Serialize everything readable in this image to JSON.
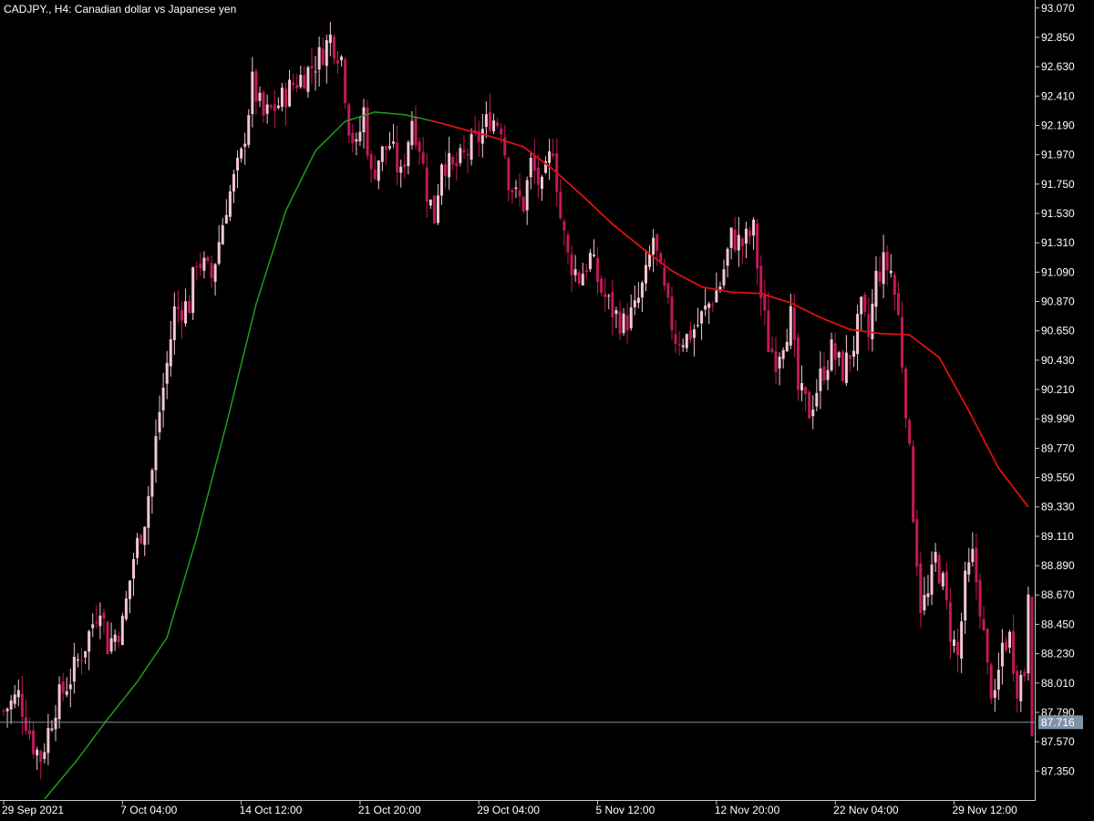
{
  "chart_title": "CADJPY., H4:  Canadian dollar vs Japanese yen",
  "colors": {
    "background": "#000000",
    "axis_line": "#c8c8c8",
    "candle_bear": "#c2185b",
    "candle_bull": "#f2c6d2",
    "ma_rising": "#1e9e1e",
    "ma_falling": "#e01010",
    "price_line": "#7f93a8",
    "price_label_bg": "#7f93a8"
  },
  "chart_data": {
    "type": "candlestick",
    "symbol": "CADJPY.",
    "timeframe": "H4",
    "y_ticks": [
      "93.070",
      "92.850",
      "92.630",
      "92.410",
      "92.190",
      "91.970",
      "91.750",
      "91.530",
      "91.310",
      "91.090",
      "90.870",
      "90.650",
      "90.430",
      "90.210",
      "89.990",
      "89.770",
      "89.550",
      "89.330",
      "89.110",
      "88.890",
      "88.670",
      "88.450",
      "88.230",
      "88.010",
      "87.790",
      "87.570",
      "87.350"
    ],
    "ylim": [
      87.14,
      93.13
    ],
    "x_ticks": [
      {
        "label": "29 Sep 2021",
        "bar": 0
      },
      {
        "label": "7 Oct 04:00",
        "bar": 32
      },
      {
        "label": "14 Oct 12:00",
        "bar": 64
      },
      {
        "label": "21 Oct 20:00",
        "bar": 96
      },
      {
        "label": "29 Oct 04:00",
        "bar": 128
      },
      {
        "label": "5 Nov 12:00",
        "bar": 160
      },
      {
        "label": "12 Nov 20:00",
        "bar": 192
      },
      {
        "label": "22 Nov 04:00",
        "bar": 224
      },
      {
        "label": "29 Nov 12:00",
        "bar": 256
      }
    ],
    "current_price": "87.716",
    "current_price_value": 87.716,
    "bar_count": 278,
    "price_path": [
      [
        0,
        87.8
      ],
      [
        4,
        87.92
      ],
      [
        8,
        87.55
      ],
      [
        10,
        87.45
      ],
      [
        14,
        87.85
      ],
      [
        18,
        88.05
      ],
      [
        22,
        88.3
      ],
      [
        26,
        88.62
      ],
      [
        28,
        88.3
      ],
      [
        32,
        88.45
      ],
      [
        35,
        88.95
      ],
      [
        38,
        89.25
      ],
      [
        40,
        89.6
      ],
      [
        42,
        90.05
      ],
      [
        44,
        90.4
      ],
      [
        46,
        90.8
      ],
      [
        50,
        90.85
      ],
      [
        52,
        91.2
      ],
      [
        56,
        91.05
      ],
      [
        60,
        91.6
      ],
      [
        64,
        91.95
      ],
      [
        67,
        92.5
      ],
      [
        70,
        92.25
      ],
      [
        74,
        92.35
      ],
      [
        78,
        92.5
      ],
      [
        82,
        92.6
      ],
      [
        85,
        92.7
      ],
      [
        88,
        92.85
      ],
      [
        91,
        92.7
      ],
      [
        93,
        92.2
      ],
      [
        95,
        92.0
      ],
      [
        97,
        92.3
      ],
      [
        99,
        91.8
      ],
      [
        101,
        91.95
      ],
      [
        104,
        92.05
      ],
      [
        107,
        91.8
      ],
      [
        110,
        92.25
      ],
      [
        112,
        92.05
      ],
      [
        114,
        91.7
      ],
      [
        116,
        91.5
      ],
      [
        118,
        91.95
      ],
      [
        121,
        91.85
      ],
      [
        124,
        91.95
      ],
      [
        128,
        92.1
      ],
      [
        131,
        92.25
      ],
      [
        134,
        92.2
      ],
      [
        136,
        91.8
      ],
      [
        138,
        91.65
      ],
      [
        140,
        91.6
      ],
      [
        142,
        91.9
      ],
      [
        145,
        91.7
      ],
      [
        148,
        92.05
      ],
      [
        150,
        91.5
      ],
      [
        152,
        91.2
      ],
      [
        155,
        91.05
      ],
      [
        158,
        91.2
      ],
      [
        161,
        90.95
      ],
      [
        164,
        90.8
      ],
      [
        167,
        90.7
      ],
      [
        170,
        90.8
      ],
      [
        173,
        91.05
      ],
      [
        175,
        91.35
      ],
      [
        177,
        91.05
      ],
      [
        179,
        90.8
      ],
      [
        181,
        90.6
      ],
      [
        184,
        90.6
      ],
      [
        187,
        90.7
      ],
      [
        190,
        90.85
      ],
      [
        193,
        91.0
      ],
      [
        196,
        91.35
      ],
      [
        199,
        91.3
      ],
      [
        202,
        91.4
      ],
      [
        204,
        90.9
      ],
      [
        206,
        90.55
      ],
      [
        208,
        90.45
      ],
      [
        210,
        90.6
      ],
      [
        212,
        90.75
      ],
      [
        214,
        90.2
      ],
      [
        217,
        90.05
      ],
      [
        220,
        90.3
      ],
      [
        223,
        90.5
      ],
      [
        226,
        90.35
      ],
      [
        229,
        90.55
      ],
      [
        231,
        90.8
      ],
      [
        233,
        90.6
      ],
      [
        235,
        91.05
      ],
      [
        237,
        91.15
      ],
      [
        239,
        91.1
      ],
      [
        241,
        90.75
      ],
      [
        243,
        90.1
      ],
      [
        245,
        89.3
      ],
      [
        247,
        88.6
      ],
      [
        249,
        88.65
      ],
      [
        251,
        88.95
      ],
      [
        253,
        88.75
      ],
      [
        255,
        88.4
      ],
      [
        257,
        88.2
      ],
      [
        259,
        88.75
      ],
      [
        261,
        88.95
      ],
      [
        263,
        88.6
      ],
      [
        265,
        88.1
      ],
      [
        267,
        87.85
      ],
      [
        269,
        88.3
      ],
      [
        271,
        88.35
      ],
      [
        273,
        88.0
      ],
      [
        275,
        88.1
      ],
      [
        276,
        88.75
      ],
      [
        277,
        87.72
      ]
    ],
    "moving_average": [
      [
        11,
        87.14
      ],
      [
        20,
        87.44
      ],
      [
        28,
        87.74
      ],
      [
        36,
        88.02
      ],
      [
        44,
        88.35
      ],
      [
        52,
        89.1
      ],
      [
        60,
        89.95
      ],
      [
        68,
        90.85
      ],
      [
        76,
        91.55
      ],
      [
        84,
        92.0
      ],
      [
        92,
        92.22
      ],
      [
        100,
        92.29
      ],
      [
        108,
        92.27
      ],
      [
        116,
        92.22
      ],
      [
        124,
        92.16
      ],
      [
        132,
        92.1
      ],
      [
        140,
        92.03
      ],
      [
        148,
        91.86
      ],
      [
        156,
        91.66
      ],
      [
        164,
        91.45
      ],
      [
        172,
        91.27
      ],
      [
        180,
        91.1
      ],
      [
        188,
        90.98
      ],
      [
        196,
        90.94
      ],
      [
        204,
        90.93
      ],
      [
        212,
        90.86
      ],
      [
        220,
        90.75
      ],
      [
        228,
        90.66
      ],
      [
        236,
        90.63
      ],
      [
        244,
        90.62
      ],
      [
        252,
        90.45
      ],
      [
        260,
        90.05
      ],
      [
        268,
        89.62
      ],
      [
        276,
        89.33
      ]
    ],
    "ma_color_switch_bar": 116
  }
}
